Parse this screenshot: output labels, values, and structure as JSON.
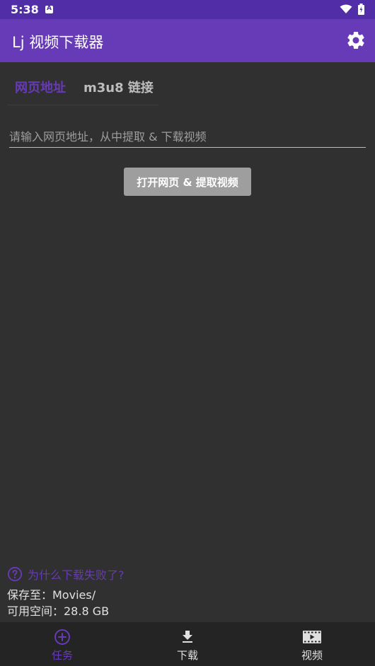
{
  "status_bar": {
    "time": "5:38"
  },
  "app_bar": {
    "title": "Lj 视频下载器"
  },
  "tabs": [
    {
      "label": "网页地址",
      "selected": true
    },
    {
      "label": "m3u8 链接",
      "selected": false
    }
  ],
  "url_input": {
    "placeholder": "请输入网页地址，从中提取 & 下载视频",
    "value": ""
  },
  "extract_button": {
    "label": "打开网页 & 提取视频"
  },
  "info": {
    "help_link": "为什么下载失败了?",
    "save_path": "保存至：Movies/",
    "free_space": "可用空间：28.8 GB"
  },
  "bottom_nav": [
    {
      "label": "任务",
      "icon": "add-circle-icon",
      "selected": true
    },
    {
      "label": "下载",
      "icon": "download-icon",
      "selected": false
    },
    {
      "label": "视频",
      "icon": "video-film-icon",
      "selected": false
    }
  ],
  "colors": {
    "accent": "#673ab7",
    "status_bar": "#512da8",
    "background": "#303030",
    "button": "#9e9e9e"
  }
}
